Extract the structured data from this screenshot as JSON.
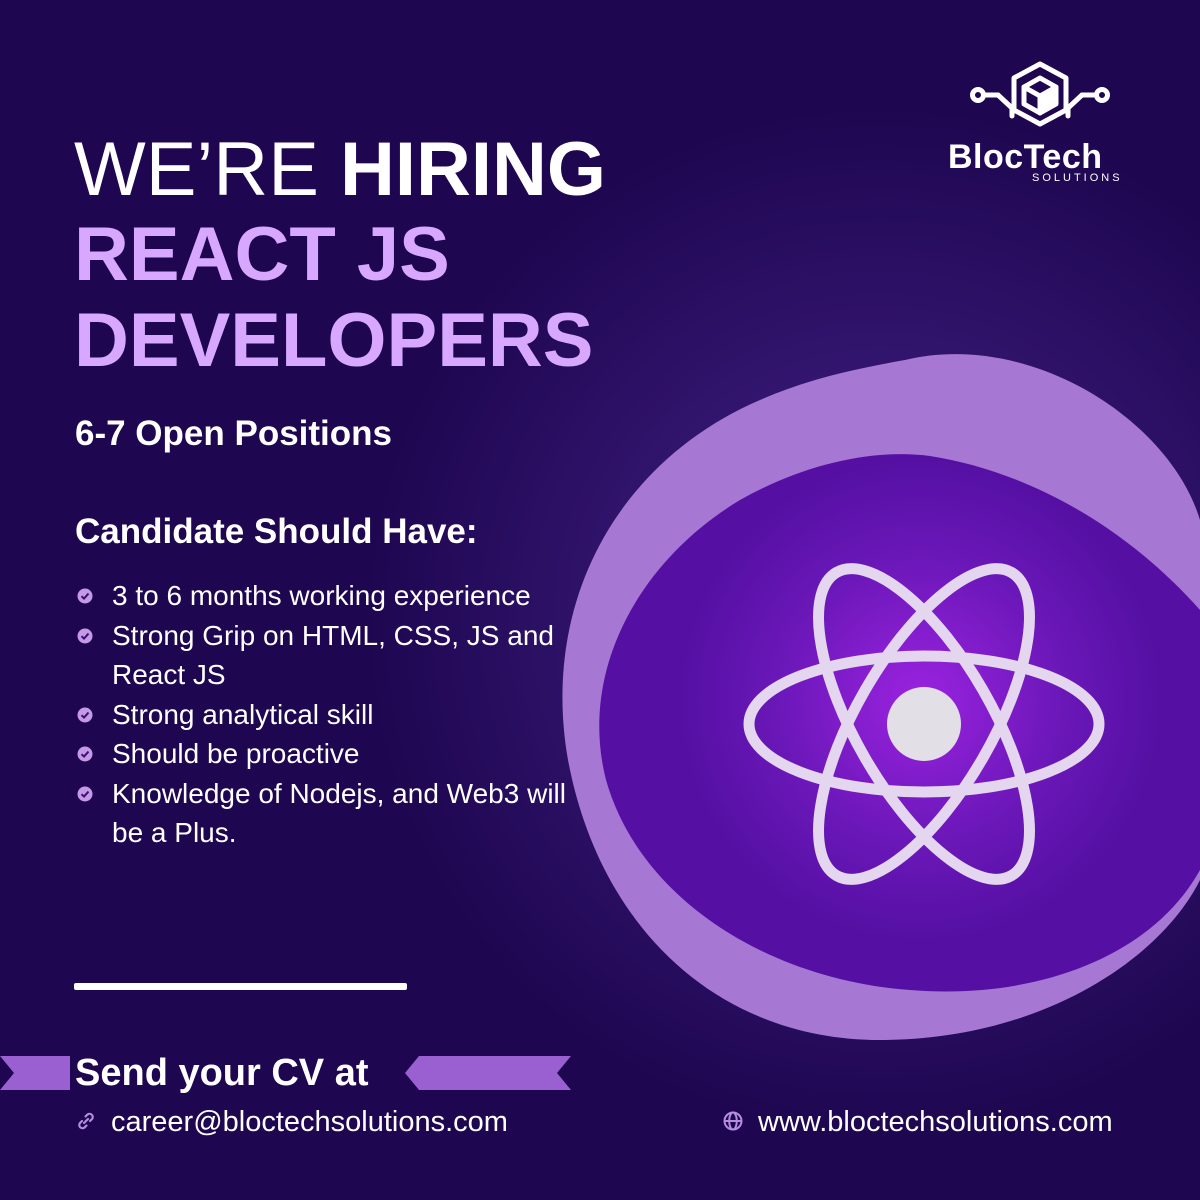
{
  "brand": {
    "name": "BlocTech",
    "tagline": "SOLUTIONS",
    "logo_icon": "cube-circuit-logo"
  },
  "headline": {
    "prefix": "WE’RE",
    "emphasis": "HIRING",
    "role_line1": "REACT JS",
    "role_line2": "DEVELOPERS"
  },
  "positions": "6-7 Open Positions",
  "requirements": {
    "heading": "Candidate Should Have:",
    "items": [
      "3 to 6 months working experience",
      "Strong Grip on HTML, CSS, JS and React JS",
      "Strong analytical skill",
      "Should be proactive",
      "Knowledge of Nodejs, and Web3 will be a Plus."
    ]
  },
  "cta": {
    "heading": "Send your CV at",
    "email": "career@bloctechsolutions.com",
    "email_icon": "link-icon",
    "website": "www.bloctechsolutions.com",
    "website_icon": "globe-icon"
  },
  "illustration": {
    "icon": "react-atom-icon"
  },
  "colors": {
    "background": "#1e0650",
    "accent": "#d8a7ff",
    "blob_light": "#a678d4",
    "blob_dark": "#5b14a8",
    "ribbon": "#9a5fd0"
  }
}
